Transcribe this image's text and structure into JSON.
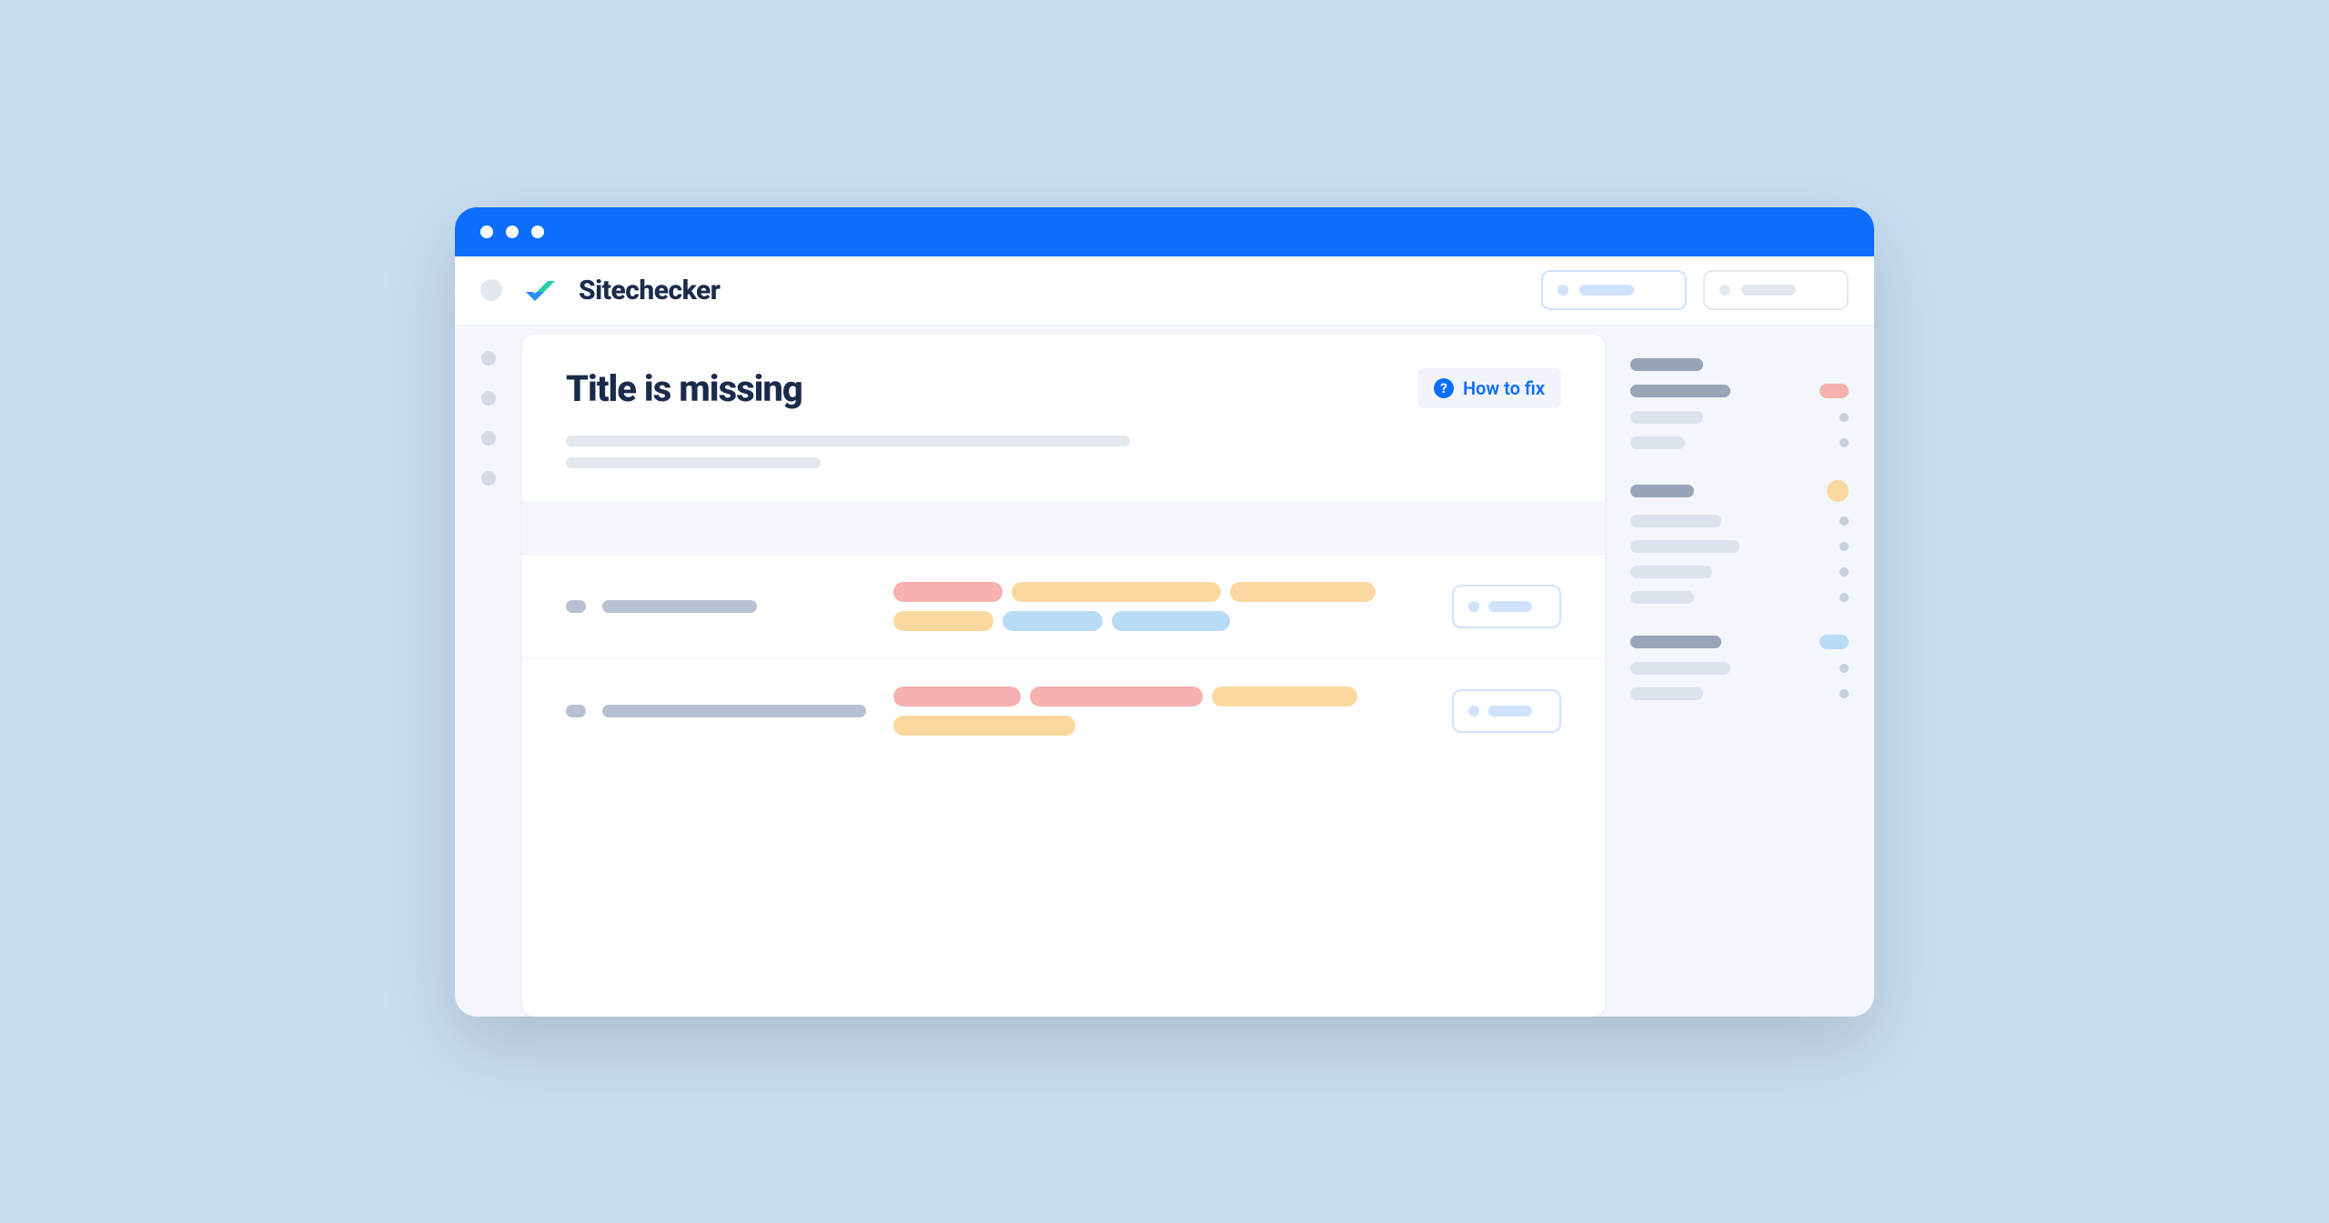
{
  "brand": "Sitechecker",
  "issue": {
    "title": "Title is missing",
    "how_to_fix_label": "How to fix"
  }
}
